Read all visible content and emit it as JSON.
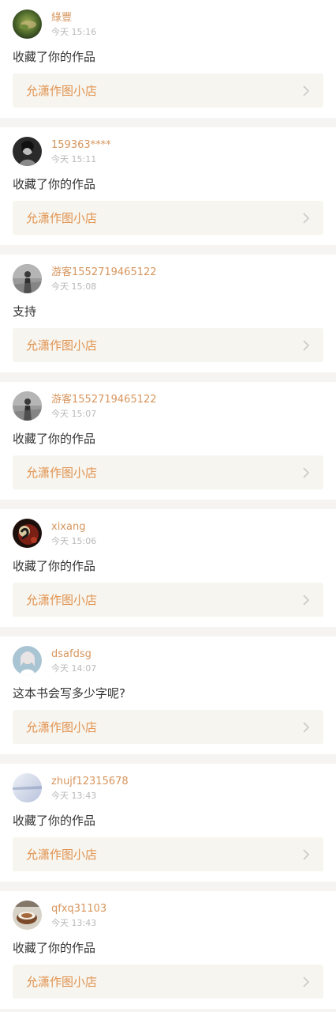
{
  "colors": {
    "background": "#f6f4f3",
    "card": "#ffffff",
    "username": "#d7955d",
    "timestamp": "#b9b9b9",
    "comment": "#333333",
    "shop_box": "#f6f5ef",
    "shop_name": "#e2924f"
  },
  "items": [
    {
      "username": "綠豐",
      "time": "今天 15:16",
      "comment": "收藏了你的作品",
      "shop": "允潇作图小店",
      "avatar_icon": "avatar-green-photo"
    },
    {
      "username": "159363****",
      "time": "今天 15:11",
      "comment": "收藏了你的作品",
      "shop": "允潇作图小店",
      "avatar_icon": "avatar-bw-portrait"
    },
    {
      "username": "游客1552719465122",
      "time": "今天 15:08",
      "comment": "支持",
      "shop": "允潇作图小店",
      "avatar_icon": "avatar-gray-figure"
    },
    {
      "username": "游客1552719465122",
      "time": "今天 15:07",
      "comment": "收藏了你的作品",
      "shop": "允潇作图小店",
      "avatar_icon": "avatar-gray-figure"
    },
    {
      "username": "xixang",
      "time": "今天 15:06",
      "comment": "收藏了你的作品",
      "shop": "允潇作图小店",
      "avatar_icon": "avatar-dark-red-art"
    },
    {
      "username": "dsafdsg",
      "time": "今天 14:07",
      "comment": "这本书会写多少字呢?",
      "shop": "允潇作图小店",
      "avatar_icon": "avatar-blue-girl"
    },
    {
      "username": "zhujf12315678",
      "time": "今天 13:43",
      "comment": "收藏了你的作品",
      "shop": "允潇作图小店",
      "avatar_icon": "avatar-light-sky"
    },
    {
      "username": "qfxq31103",
      "time": "今天 13:43",
      "comment": "收藏了你的作品",
      "shop": "允潇作图小店",
      "avatar_icon": "avatar-teacup"
    }
  ]
}
